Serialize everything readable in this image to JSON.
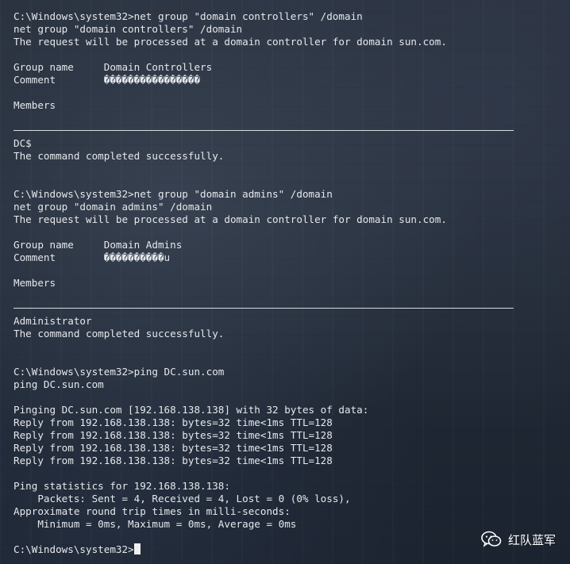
{
  "terminal": {
    "lines": [
      "C:\\Windows\\system32>net group \"domain controllers\" /domain",
      "net group \"domain controllers\" /domain",
      "The request will be processed at a domain controller for domain sun.com.",
      "",
      "Group name     Domain Controllers",
      "Comment        ����������������",
      "",
      "Members",
      "",
      "---RULE---",
      "DC$",
      "The command completed successfully.",
      "",
      "",
      "C:\\Windows\\system32>net group \"domain admins\" /domain",
      "net group \"domain admins\" /domain",
      "The request will be processed at a domain controller for domain sun.com.",
      "",
      "Group name     Domain Admins",
      "Comment        ����������u",
      "",
      "Members",
      "",
      "---RULE---",
      "Administrator",
      "The command completed successfully.",
      "",
      "",
      "C:\\Windows\\system32>ping DC.sun.com",
      "ping DC.sun.com",
      "",
      "Pinging DC.sun.com [192.168.138.138] with 32 bytes of data:",
      "Reply from 192.168.138.138: bytes=32 time<1ms TTL=128",
      "Reply from 192.168.138.138: bytes=32 time<1ms TTL=128",
      "Reply from 192.168.138.138: bytes=32 time<1ms TTL=128",
      "Reply from 192.168.138.138: bytes=32 time<1ms TTL=128",
      "",
      "Ping statistics for 192.168.138.138:",
      "    Packets: Sent = 4, Received = 4, Lost = 0 (0% loss),",
      "Approximate round trip times in milli-seconds:",
      "    Minimum = 0ms, Maximum = 0ms, Average = 0ms",
      "",
      "C:\\Windows\\system32>"
    ]
  },
  "watermark": {
    "icon": "wechat-icon",
    "text": "红队蓝军"
  },
  "colors": {
    "text": "#e6e8ec",
    "background": "#222a36"
  }
}
